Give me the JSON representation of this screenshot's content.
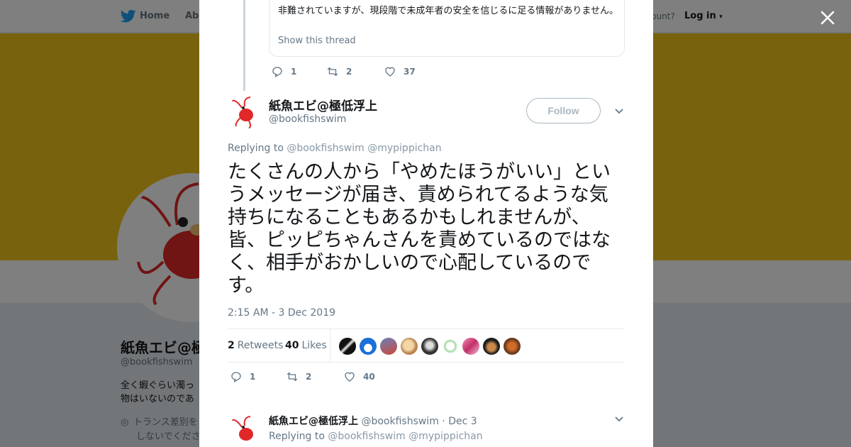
{
  "background": {
    "nav": {
      "home": "Home",
      "about": "Abo",
      "have_account": "ccount?",
      "login": "Log in"
    },
    "profile": {
      "name": "紙魚エビ@極",
      "handle": "@bookfishswim",
      "bio_line1": "全く蝦ぐらい濁っ",
      "bio_line2": "物はいないのであ",
      "location_line1": "トランス差別を",
      "location_line2": "しないでくださ"
    },
    "colors": {
      "banner": "#f3c41b"
    }
  },
  "modal": {
    "quoted": {
      "text": "非難されていますが、現段階で未成年者の安全を信じるに足る情報がありません。",
      "show_thread": "Show this thread"
    },
    "prev_actions": {
      "replies": "1",
      "retweets": "2",
      "likes": "37"
    },
    "tweet": {
      "author_name": "紙魚エビ@極低浮上",
      "author_handle": "@bookfishswim",
      "follow_label": "Follow",
      "replying_to_label": "Replying to",
      "replying_to_1": "@bookfishswim",
      "replying_to_2": "@mypippichan",
      "text": "たくさんの人から「やめたほうがいい」というメッセージが届き、責められてるような気持ちになることもあるかもしれませんが、皆、ピッピちゃんさんを責めているのではなく、相手がおかしいので心配しているのです。",
      "timestamp": "2:15 AM - 3 Dec 2019",
      "retweets_count": "2",
      "retweets_label": "Retweets",
      "likes_count": "40",
      "likes_label": "Likes",
      "actions": {
        "replies": "1",
        "retweets": "2",
        "likes": "40"
      }
    },
    "next_reply": {
      "author_name": "紙魚エビ@極低浮上",
      "author_handle": "@bookfishswim",
      "date": "· Dec 3",
      "replying_to_label": "Replying to",
      "replying_to_1": "@bookfishswim",
      "replying_to_2": "@mypippichan"
    }
  },
  "icons": {
    "close": "close-icon",
    "reply": "reply-icon",
    "retweet": "retweet-icon",
    "like": "heart-icon",
    "more": "chevron-down-icon",
    "logo": "twitter-bird-icon",
    "location": "location-pin-icon"
  },
  "colors": {
    "twitter_blue": "#1da1f2",
    "text_primary": "#14171a",
    "text_secondary": "#657786"
  }
}
